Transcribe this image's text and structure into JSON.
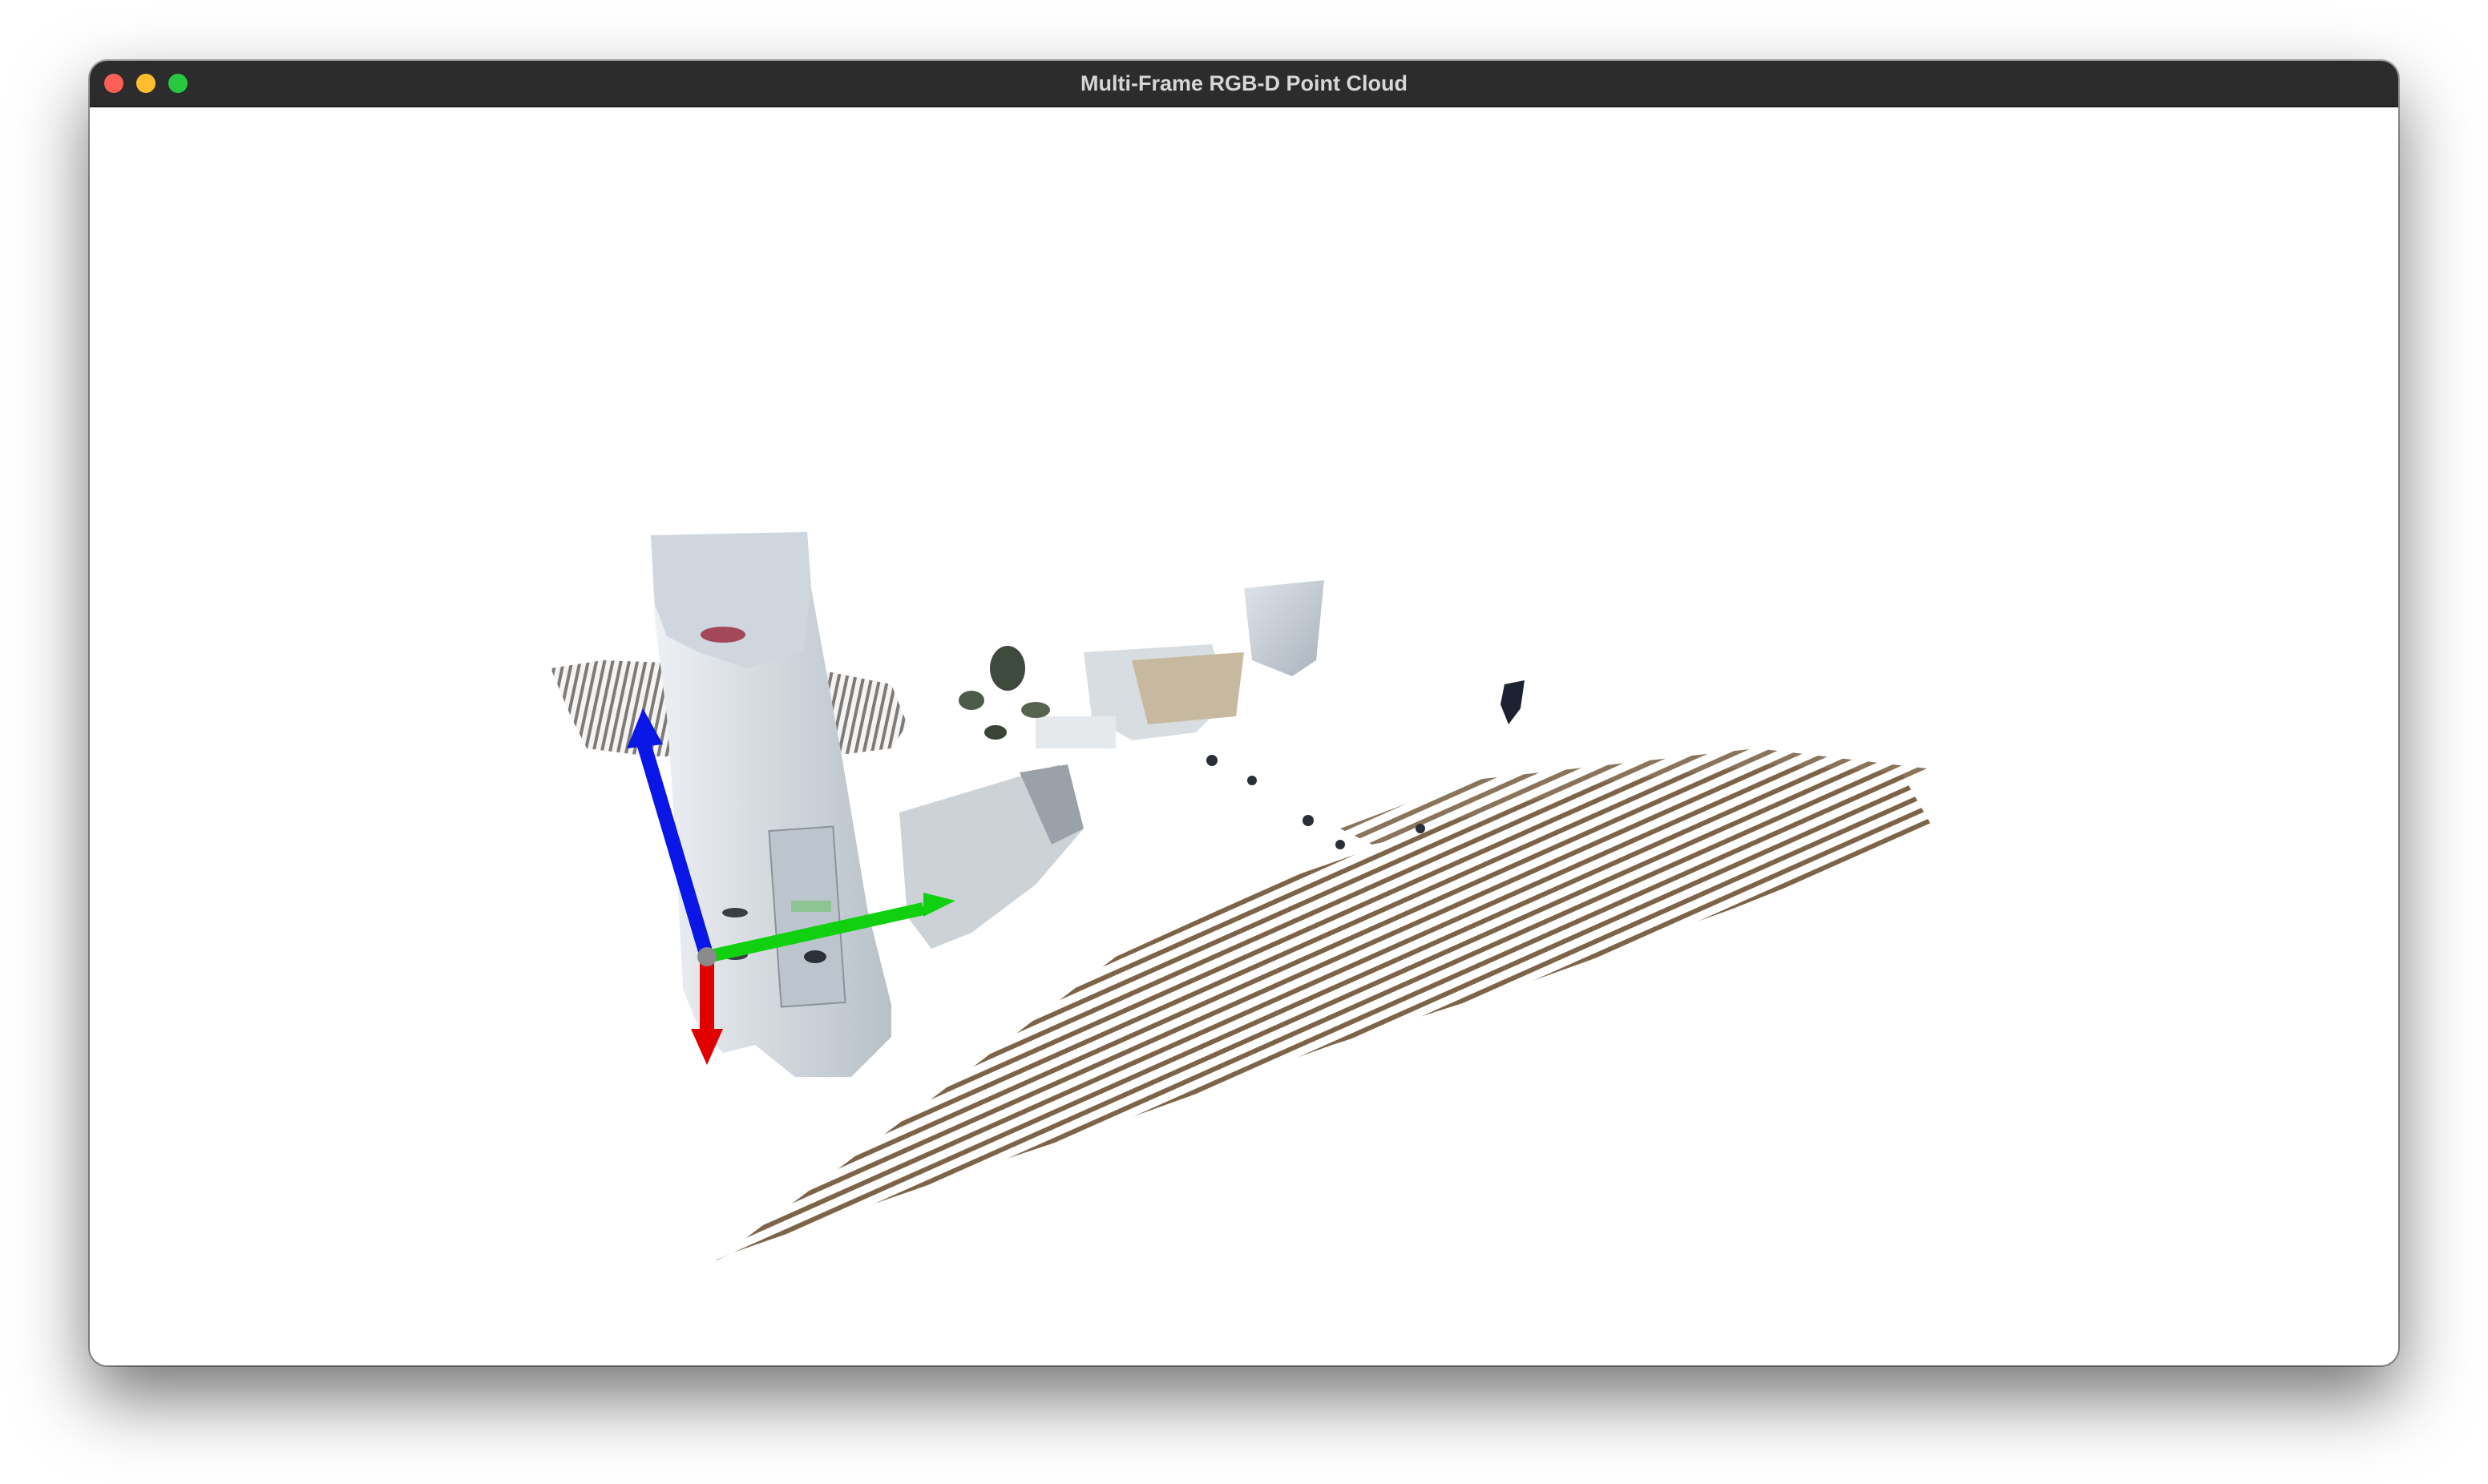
{
  "window": {
    "title": "Multi-Frame RGB-D Point Cloud"
  },
  "scene": {
    "content": "rgbd-point-cloud",
    "axes": {
      "x_color": "#e00000",
      "y_color": "#10d010",
      "z_color": "#0a16e6"
    },
    "colors": {
      "wall": "#c9d0d8",
      "floor": "#8a6f52",
      "plant": "#3f4a3a",
      "dark": "#1d2233"
    }
  }
}
